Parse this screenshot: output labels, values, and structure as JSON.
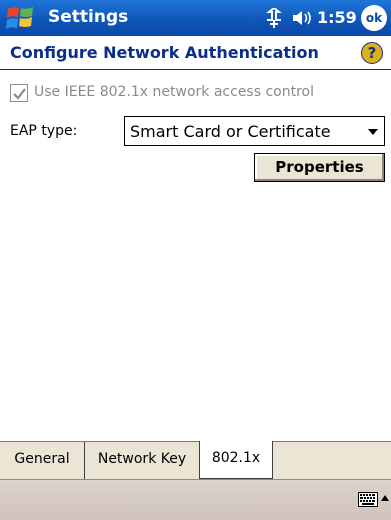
{
  "titlebar": {
    "app_title": "Settings",
    "clock": "1:59",
    "ok_label": "ok"
  },
  "header": {
    "title": "Configure Network Authentication",
    "help_glyph": "?"
  },
  "auth": {
    "use_8021x_label": "Use IEEE 802.1x network access control",
    "use_8021x_checked": true,
    "eap_label": "EAP type:",
    "eap_value": "Smart Card or Certificate",
    "properties_label": "Properties"
  },
  "tabs": [
    {
      "label": "General",
      "active": false
    },
    {
      "label": "Network Key",
      "active": false
    },
    {
      "label": "802.1x",
      "active": true
    }
  ],
  "colors": {
    "titlebar": "#0e55b8",
    "header_title": "#0a2f8a",
    "disabled_text": "#8a8a8a",
    "button_face": "#eae5d4"
  },
  "icons": {
    "start": "windows-flag-icon",
    "connectivity": "connectivity-icon",
    "volume": "volume-icon",
    "help": "help-icon",
    "keyboard": "keyboard-icon"
  }
}
